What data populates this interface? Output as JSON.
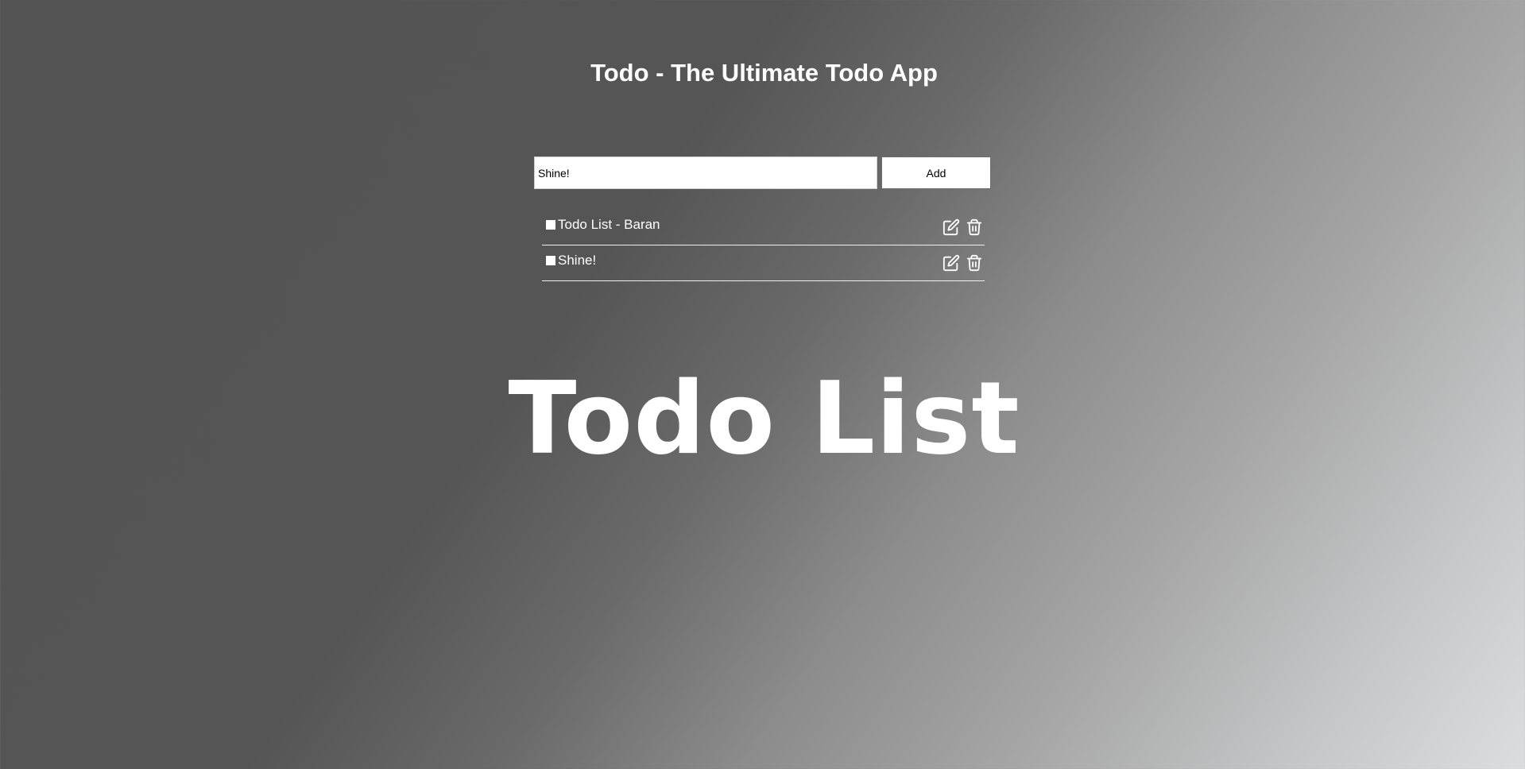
{
  "header": {
    "title": "Todo - The Ultimate Todo App"
  },
  "form": {
    "input_value": "Shine!",
    "add_label": "Add"
  },
  "todos": [
    {
      "label": "Todo List - Baran",
      "done": false
    },
    {
      "label": "Shine!",
      "done": false
    }
  ],
  "icons": {
    "edit": "edit-icon",
    "delete": "trash-icon"
  },
  "hero": {
    "text": "Todo List"
  }
}
